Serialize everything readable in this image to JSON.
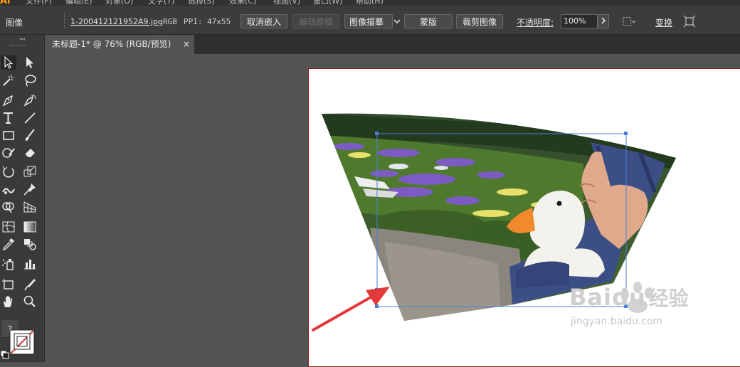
{
  "app": {
    "logo": "Ai",
    "menu": [
      "文件(F)",
      "编辑(E)",
      "对象(O)",
      "文字(T)",
      "选择(S)",
      "效果(C)",
      "视图(V)",
      "窗口(W)",
      "帮助(H)"
    ]
  },
  "control_bar": {
    "object_type": "图像",
    "filename": "1-200412121952A9.jpg",
    "color_mode": "RGB",
    "ppi": "PPI: 47x55",
    "buttons": {
      "unembed": "取消嵌入",
      "edit_original": "编辑原稿",
      "image_trace": "图像描摹",
      "mask": "蒙版",
      "crop_image": "裁剪图像"
    },
    "opacity_label": "不透明度:",
    "opacity_value": "100%",
    "transform_label": "变换"
  },
  "document": {
    "tab_title": "未标题-1* @ 76% (RGB/预览)",
    "close_glyph": "×"
  },
  "tools": {
    "help": "?"
  },
  "watermark": {
    "brand": "Baidu",
    "cn": "经验",
    "url": "jingyan.baidu.com"
  },
  "colors": {
    "artboard_border": "#8c1e1e",
    "selection": "#4a7fd6",
    "arrow": "#e23a3a",
    "accent_logo": "#ff9a00"
  }
}
